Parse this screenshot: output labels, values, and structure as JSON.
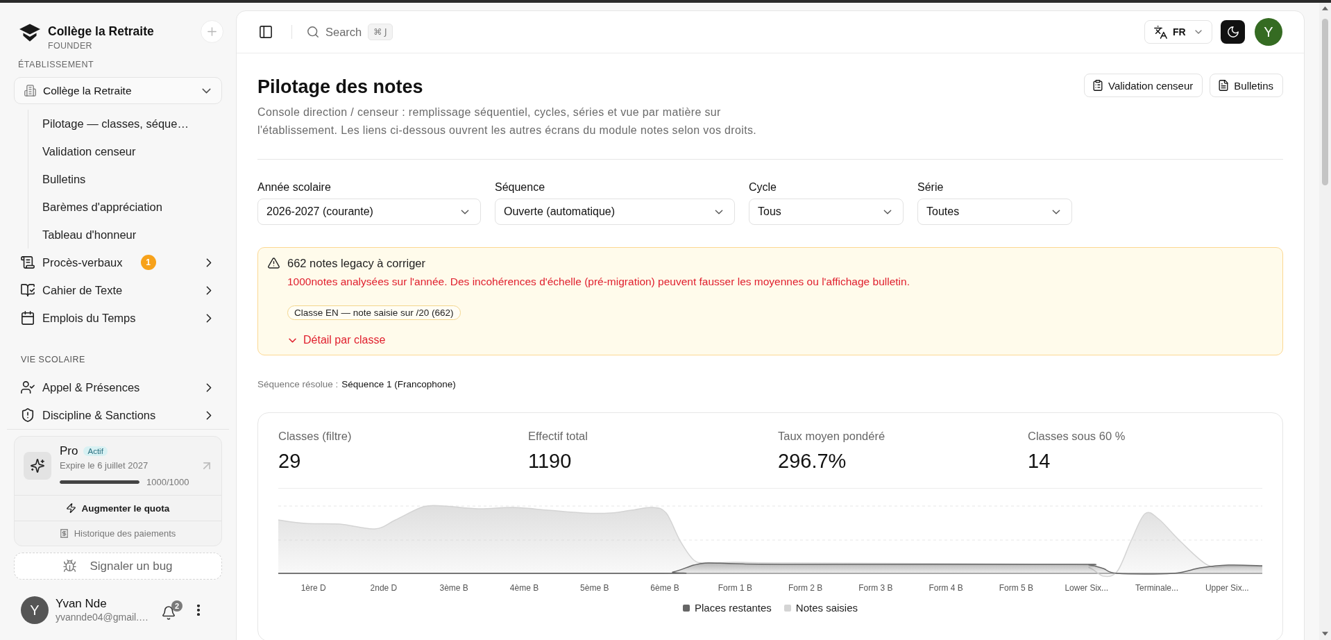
{
  "sidebar": {
    "brand": {
      "name": "Collège la Retraite",
      "role": "FOUNDER"
    },
    "sections": [
      {
        "title": "ÉTABLISSEMENT",
        "select": {
          "value": "Collège la Retraite"
        },
        "links": [
          {
            "label": "Pilotage — classes, séque…",
            "selected": false
          },
          {
            "label": "Validation censeur",
            "selected": false
          },
          {
            "label": "Bulletins",
            "selected": false
          },
          {
            "label": "Barèmes d'appréciation",
            "selected": false
          },
          {
            "label": "Tableau d'honneur",
            "selected": false
          }
        ],
        "groups": [
          {
            "label": "Procès-verbaux",
            "badge": "1",
            "expanded": false
          },
          {
            "label": "Cahier de Texte",
            "expanded": false
          },
          {
            "label": "Emplois du Temps",
            "expanded": false
          }
        ]
      },
      {
        "title": "VIE SCOLAIRE",
        "groups": [
          {
            "label": "Appel & Présences",
            "expanded": false
          },
          {
            "label": "Discipline & Sanctions",
            "expanded": false
          }
        ]
      }
    ],
    "plan": {
      "name": "Pro",
      "status": "Actif",
      "expiry": "Expire le 6 juillet 2027",
      "quota": {
        "level": 1,
        "reading": "1000/1000"
      },
      "upgrade": "Augmenter le quota",
      "history": "Historique des paiements"
    },
    "bug_report": "Signaler un bug",
    "user": {
      "initial": "Y",
      "name": "Yvan Nde",
      "email": "yvannde04@gmail.…",
      "notifications": "2"
    }
  },
  "topbar": {
    "search": {
      "label": "Search",
      "shortcut": "⌘ J"
    },
    "language": "FR",
    "avatar": "Y"
  },
  "page": {
    "title": "Pilotage des notes",
    "description": "Console direction / censeur : remplissage séquentiel, cycles, séries et vue par matière sur l'établissement. Les liens ci-dessous ouvrent les autres écrans du module notes selon vos droits.",
    "actions": [
      "Validation censeur",
      "Bulletins"
    ],
    "filters": [
      {
        "label": "Année scolaire",
        "value": "2026-2027 (courante)"
      },
      {
        "label": "Séquence",
        "value": "Ouverte (automatique)"
      },
      {
        "label": "Cycle",
        "value": "Tous"
      },
      {
        "label": "Série",
        "value": "Toutes"
      }
    ],
    "alert": {
      "title": "662 notes legacy à corriger",
      "message": "1000notes analysées sur l'année. Des incohérences d'échelle (pré-migration) peuvent fausser les moyennes ou l'affichage bulletin.",
      "tags": [
        "Classe EN — note saisie sur /20 (662)"
      ],
      "toggle": {
        "label": "Détail par classe",
        "expanded": false
      }
    },
    "resolved_sequence": {
      "label": "Séquence résolue :",
      "value": "Séquence 1 (Francophone)"
    },
    "stats": [
      {
        "label": "Classes (filtre)",
        "value": "29"
      },
      {
        "label": "Effectif total",
        "value": "1190"
      },
      {
        "label": "Taux moyen pondéré",
        "value": "296.7%"
      },
      {
        "label": "Classes sous 60 %",
        "value": "14"
      }
    ],
    "chart": {
      "x_labels": [
        "1ère D",
        "2nde D",
        "3ème B",
        "4ème B",
        "5ème B",
        "6ème B",
        "Form 1 B",
        "Form 2 B",
        "Form 3 B",
        "Form 4 B",
        "Form 5 B",
        "Lower Six...",
        "Terminale...",
        "Upper Six..."
      ],
      "legend": [
        {
          "label": "Places restantes",
          "color": "#666666"
        },
        {
          "label": "Notes saisies",
          "color": "#d4d4d4"
        }
      ]
    }
  }
}
